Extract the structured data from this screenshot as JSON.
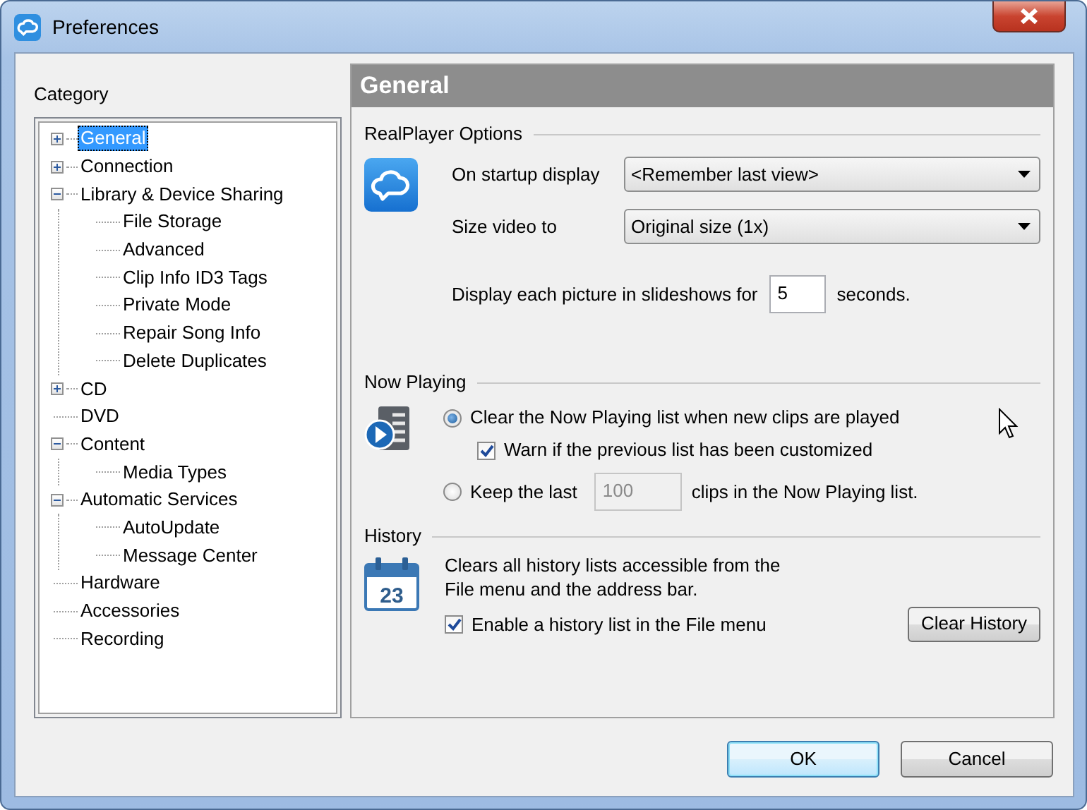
{
  "window": {
    "title": "Preferences"
  },
  "category": {
    "label": "Category",
    "tree": [
      {
        "label": "General",
        "expanded": false,
        "selected": true
      },
      {
        "label": "Connection",
        "expanded": false,
        "selected": false
      },
      {
        "label": "Library & Device Sharing",
        "expanded": true,
        "selected": false,
        "children": [
          {
            "label": "File Storage",
            "selected": false
          },
          {
            "label": "Advanced",
            "selected": false
          },
          {
            "label": "Clip Info ID3 Tags",
            "selected": false
          },
          {
            "label": "Private Mode",
            "selected": false
          },
          {
            "label": "Repair Song Info",
            "selected": false
          },
          {
            "label": "Delete Duplicates",
            "selected": false
          }
        ]
      },
      {
        "label": "CD",
        "expanded": false,
        "selected": false
      },
      {
        "label": "DVD",
        "selected": false
      },
      {
        "label": "Content",
        "expanded": true,
        "selected": false,
        "children": [
          {
            "label": "Media Types",
            "selected": false
          }
        ]
      },
      {
        "label": "Automatic Services",
        "expanded": true,
        "selected": false,
        "children": [
          {
            "label": "AutoUpdate",
            "selected": false
          },
          {
            "label": "Message Center",
            "selected": false
          }
        ]
      },
      {
        "label": "Hardware",
        "selected": false
      },
      {
        "label": "Accessories",
        "selected": false
      },
      {
        "label": "Recording",
        "selected": false
      }
    ]
  },
  "panel": {
    "title": "General",
    "realplayer_options": {
      "title": "RealPlayer Options",
      "startup_display": {
        "label": "On startup display",
        "value": "<Remember last view>"
      },
      "size_video": {
        "label": "Size video to",
        "value": "Original size (1x)"
      },
      "slideshow": {
        "label": "Display each picture in slideshows for",
        "value": "5",
        "unit": "seconds."
      }
    },
    "now_playing": {
      "title": "Now Playing",
      "clear_option": {
        "label": "Clear the Now Playing list when new clips are played",
        "selected": true
      },
      "warn_option": {
        "label": "Warn if the previous list has been customized",
        "checked": true
      },
      "keep_option": {
        "label": "Keep the last",
        "selected": false,
        "count": {
          "value": "100",
          "disabled": true
        },
        "suffix": "clips in the Now Playing list."
      }
    },
    "history": {
      "title": "History",
      "icon_day": "23",
      "description": [
        "Clears all history lists accessible from the",
        "File menu and the address bar."
      ],
      "enable_option": {
        "label": "Enable a history list in the File menu",
        "checked": true
      },
      "button": "Clear History"
    }
  },
  "buttons": [
    {
      "label": "OK",
      "default": true
    },
    {
      "label": "Cancel",
      "default": false
    }
  ]
}
